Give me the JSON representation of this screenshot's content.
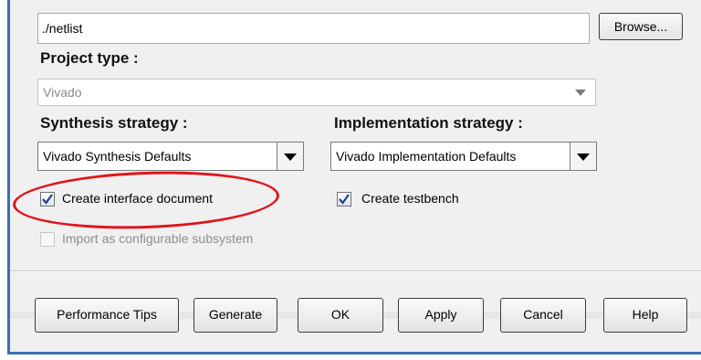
{
  "netlist": {
    "value": "./netlist",
    "browse_label": "Browse..."
  },
  "project_type": {
    "label": "Project type :",
    "value": "Vivado"
  },
  "synthesis": {
    "label": "Synthesis strategy :",
    "value": "Vivado Synthesis Defaults"
  },
  "implementation": {
    "label": "Implementation strategy :",
    "value": "Vivado Implementation Defaults"
  },
  "options": {
    "create_interface_document": {
      "label": "Create interface document",
      "checked": true
    },
    "create_testbench": {
      "label": "Create testbench",
      "checked": true
    },
    "import_configurable": {
      "label": "Import as configurable subsystem",
      "checked": false,
      "disabled": true
    }
  },
  "buttons": {
    "performance_tips": "Performance Tips",
    "generate": "Generate",
    "ok": "OK",
    "apply": "Apply",
    "cancel": "Cancel",
    "help": "Help"
  },
  "colors": {
    "frame_blue": "#3a6fb5",
    "annotation_red": "#e0141c",
    "dialog_bg": "#f0f0f0"
  }
}
